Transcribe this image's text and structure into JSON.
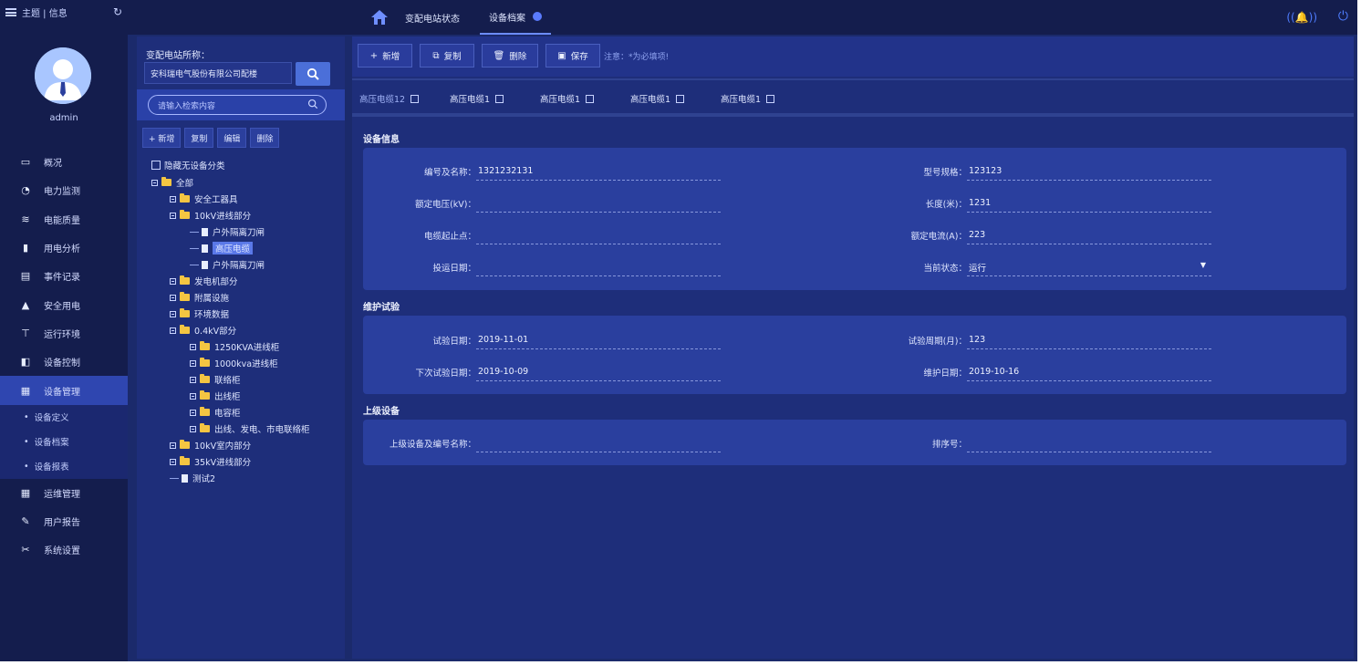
{
  "nav": {
    "topbar_label": "主题 | 信息",
    "username": "admin",
    "menu": [
      {
        "label": "概况",
        "icon": "monitor-icon"
      },
      {
        "label": "电力监测",
        "icon": "gauge-icon"
      },
      {
        "label": "电能质量",
        "icon": "wave-icon"
      },
      {
        "label": "用电分析",
        "icon": "bar-chart-icon"
      },
      {
        "label": "事件记录",
        "icon": "document-icon"
      },
      {
        "label": "安全用电",
        "icon": "alert-icon"
      },
      {
        "label": "运行环境",
        "icon": "tower-icon"
      },
      {
        "label": "设备控制",
        "icon": "control-icon"
      },
      {
        "label": "设备管理",
        "icon": "device-icon",
        "active": true
      }
    ],
    "submenu": [
      "设备定义",
      "设备档案",
      "设备报表"
    ],
    "menu2": [
      {
        "label": "运维管理",
        "icon": "grid-icon"
      },
      {
        "label": "用户报告",
        "icon": "edit-icon"
      },
      {
        "label": "系统设置",
        "icon": "tools-icon"
      }
    ]
  },
  "header": {
    "tabs": [
      {
        "label": "变配电站状态",
        "active": false
      },
      {
        "label": "设备档案",
        "active": true
      }
    ]
  },
  "tree": {
    "station_title": "变配电站所称：",
    "station_value": "安科瑞电气股份有限公司配楼",
    "search_placeholder": "请输入检索内容",
    "buttons": [
      "+ 新增",
      "复制",
      "编辑",
      "删除"
    ],
    "hide_label": "隐藏无设备分类",
    "nodes": [
      {
        "label": "全部",
        "type": "folder",
        "level": 0,
        "expander": true
      },
      {
        "label": "安全工器具",
        "type": "folder",
        "level": 1,
        "expander": true
      },
      {
        "label": "10kV进线部分",
        "type": "folder",
        "level": 1,
        "expander": true
      },
      {
        "label": "户外隔离刀闸",
        "type": "file",
        "level": 2
      },
      {
        "label": "高压电缆",
        "type": "file",
        "level": 2,
        "selected": true
      },
      {
        "label": "户外隔离刀闸",
        "type": "file",
        "level": 2
      },
      {
        "label": "发电机部分",
        "type": "folder",
        "level": 1,
        "expander": true
      },
      {
        "label": "附属设施",
        "type": "folder",
        "level": 1,
        "expander": true
      },
      {
        "label": "环境数据",
        "type": "folder",
        "level": 1,
        "expander": true
      },
      {
        "label": "0.4kV部分",
        "type": "folder",
        "level": 1,
        "expander": true
      },
      {
        "label": "1250KVA进线柜",
        "type": "folder",
        "level": 2,
        "expander": true
      },
      {
        "label": "1000kva进线柜",
        "type": "folder",
        "level": 2,
        "expander": true
      },
      {
        "label": "联络柜",
        "type": "folder",
        "level": 2,
        "expander": true
      },
      {
        "label": "出线柜",
        "type": "folder",
        "level": 2,
        "expander": true
      },
      {
        "label": "电容柜",
        "type": "folder",
        "level": 2,
        "expander": true
      },
      {
        "label": "出线、发电、市电联络柜",
        "type": "folder",
        "level": 2,
        "expander": true
      },
      {
        "label": "10kV室内部分",
        "type": "folder",
        "level": 1,
        "expander": true
      },
      {
        "label": "35kV进线部分",
        "type": "folder",
        "level": 1,
        "expander": true
      },
      {
        "label": "测试2",
        "type": "file",
        "level": 1
      }
    ]
  },
  "toolbar": {
    "new": "新增",
    "copy": "复制",
    "delete": "删除",
    "save": "保存",
    "note": "注意：*为必填项!"
  },
  "subtabs": [
    "高压电缆12",
    "高压电缆1",
    "高压电缆1",
    "高压电缆1",
    "高压电缆1"
  ],
  "sections": {
    "info_title": "设备信息",
    "maint_title": "维护试验",
    "parent_title": "上级设备"
  },
  "fields": {
    "code_name": {
      "label": "编号及名称：",
      "value": "1321232131"
    },
    "model": {
      "label": "型号规格：",
      "value": "123123"
    },
    "rated_voltage": {
      "label": "额定电压(kV)：",
      "value": ""
    },
    "length": {
      "label": "长度(米)：",
      "value": "1231"
    },
    "cable_start_end": {
      "label": "电缆起止点：",
      "value": ""
    },
    "rated_current": {
      "label": "额定电流(A)：",
      "value": "223"
    },
    "commission_date": {
      "label": "投运日期：",
      "value": ""
    },
    "current_state": {
      "label": "当前状态：",
      "value": "运行"
    },
    "test_date": {
      "label": "试验日期：",
      "value": "2019-11-01"
    },
    "test_cycle": {
      "label": "试验周期(月)：",
      "value": "123"
    },
    "next_test_date": {
      "label": "下次试验日期：",
      "value": "2019-10-09"
    },
    "maintenance_date": {
      "label": "维护日期：",
      "value": "2019-10-16"
    },
    "parent_device": {
      "label": "上级设备及编号名称：",
      "value": ""
    },
    "sort_no": {
      "label": "排序号：",
      "value": ""
    }
  }
}
